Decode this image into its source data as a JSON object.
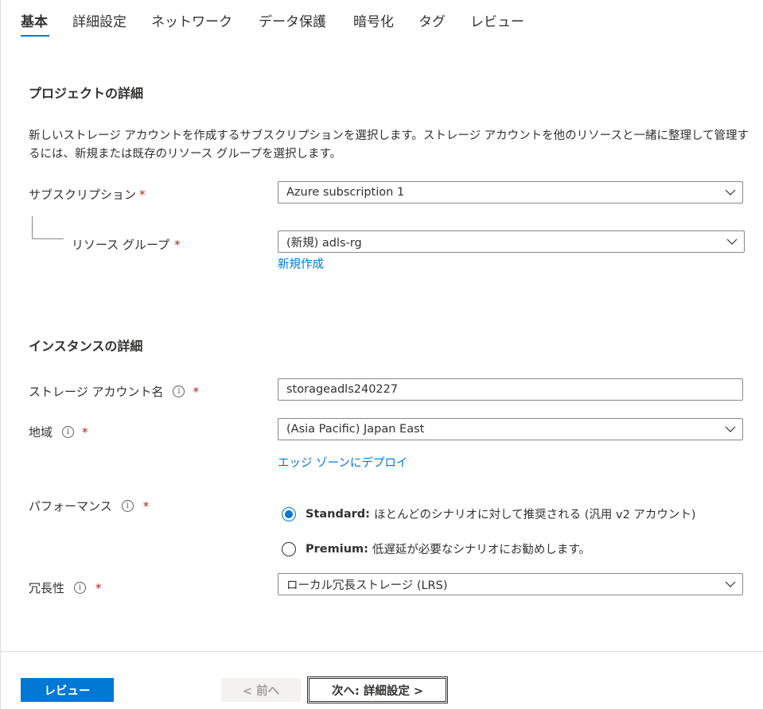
{
  "tabs": [
    {
      "label": "基本",
      "active": true
    },
    {
      "label": "詳細設定"
    },
    {
      "label": "ネットワーク"
    },
    {
      "label": "データ保護"
    },
    {
      "label": "暗号化"
    },
    {
      "label": "タグ"
    },
    {
      "label": "レビュー"
    }
  ],
  "project": {
    "title": "プロジェクトの詳細",
    "description": "新しいストレージ アカウントを作成するサブスクリプションを選択します。ストレージ アカウントを他のリソースと一緒に整理して管理するには、新規または既存のリソース グループを選択します。",
    "subscription_label": "サブスクリプション",
    "subscription_value": "Azure subscription 1",
    "resource_group_label": "リソース グループ",
    "resource_group_value": "(新規) adls-rg",
    "create_new_link": "新規作成"
  },
  "instance": {
    "title": "インスタンスの詳細",
    "account_name_label": "ストレージ アカウント名",
    "account_name_value": "storageadls240227",
    "region_label": "地域",
    "region_value": "(Asia Pacific) Japan East",
    "edge_zone_link": "エッジ ゾーンにデプロイ",
    "performance_label": "パフォーマンス",
    "performance_options": [
      {
        "name": "Standard:",
        "desc": "ほとんどのシナリオに対して推奨される (汎用 v2 アカウント)",
        "checked": true
      },
      {
        "name": "Premium:",
        "desc": "低遅延が必要なシナリオにお勧めします。",
        "checked": false
      }
    ],
    "redundancy_label": "冗長性",
    "redundancy_value": "ローカル冗長ストレージ (LRS)"
  },
  "required_mark": "*",
  "info_glyph": "i",
  "footer": {
    "review_button": "レビュー",
    "prev_button": "< 前へ",
    "next_button": "次へ: 詳細設定 >"
  },
  "colors": {
    "accent": "#0078d4",
    "required": "#a4262c",
    "text": "#323130"
  }
}
